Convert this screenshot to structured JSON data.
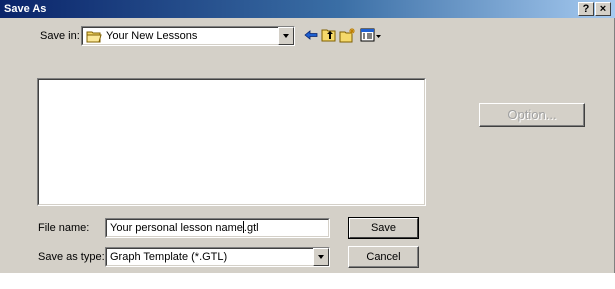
{
  "window": {
    "title": "Save As"
  },
  "title_buttons": {
    "help": "?",
    "close": "×"
  },
  "save_in": {
    "label": "Save in:",
    "value": "Your New Lessons"
  },
  "toolbar": {
    "back_icon": "back-arrow-icon",
    "up_icon": "up-folder-icon",
    "new_folder_icon": "new-folder-icon",
    "view_icon": "view-menu-icon"
  },
  "file_name": {
    "label": "File name:",
    "value_before_caret": "Your personal lesson name",
    "value_after_caret": ".gtl"
  },
  "save_as_type": {
    "label": "Save as type:",
    "value": "Graph Template (*.GTL)"
  },
  "buttons": {
    "save": "Save",
    "cancel": "Cancel",
    "option": "Option..."
  }
}
